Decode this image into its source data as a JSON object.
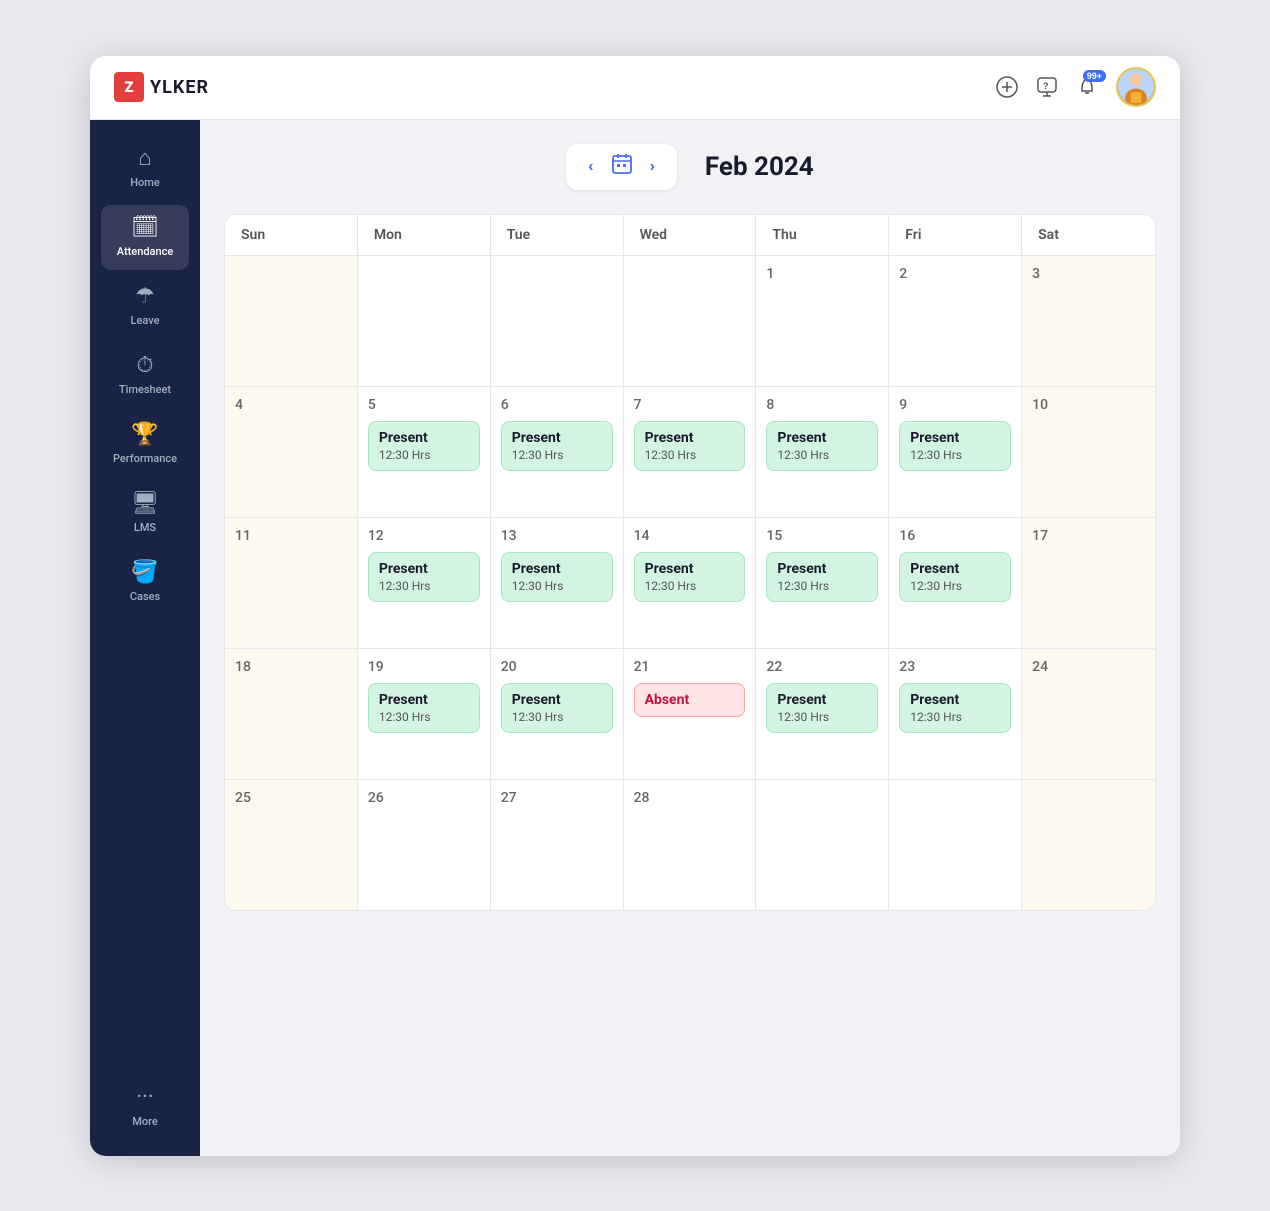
{
  "app": {
    "logo_letter": "Z",
    "logo_name": "YLKER"
  },
  "topbar": {
    "add_icon": "+",
    "help_icon": "?",
    "notif_badge": "99+",
    "notif_stars": "✦"
  },
  "sidebar": {
    "items": [
      {
        "id": "home",
        "label": "Home",
        "icon": "⌂",
        "active": false
      },
      {
        "id": "attendance",
        "label": "Attendance",
        "icon": "🗓",
        "active": true
      },
      {
        "id": "leave",
        "label": "Leave",
        "icon": "☂",
        "active": false
      },
      {
        "id": "timesheet",
        "label": "Timesheet",
        "icon": "⏱",
        "active": false
      },
      {
        "id": "performance",
        "label": "Performance",
        "icon": "🏆",
        "active": false
      },
      {
        "id": "lms",
        "label": "LMS",
        "icon": "🖥",
        "active": false
      },
      {
        "id": "cases",
        "label": "Cases",
        "icon": "🪣",
        "active": false
      },
      {
        "id": "more",
        "label": "More",
        "icon": "···",
        "active": false
      }
    ]
  },
  "calendar": {
    "prev_label": "‹",
    "next_label": "›",
    "month_year": "Feb 2024",
    "days": [
      "Sun",
      "Mon",
      "Tue",
      "Wed",
      "Thu",
      "Fri",
      "Sat"
    ],
    "rows": [
      [
        {
          "date": "",
          "events": [],
          "weekend": true
        },
        {
          "date": "",
          "events": []
        },
        {
          "date": "",
          "events": []
        },
        {
          "date": "",
          "events": []
        },
        {
          "date": "1",
          "events": []
        },
        {
          "date": "2",
          "events": []
        },
        {
          "date": "3",
          "events": [],
          "weekend": true
        }
      ],
      [
        {
          "date": "4",
          "events": [],
          "weekend": true
        },
        {
          "date": "5",
          "events": [
            {
              "type": "present",
              "title": "Present",
              "time": "12:30 Hrs"
            }
          ]
        },
        {
          "date": "6",
          "events": [
            {
              "type": "present",
              "title": "Present",
              "time": "12:30 Hrs"
            }
          ]
        },
        {
          "date": "7",
          "events": [
            {
              "type": "present",
              "title": "Present",
              "time": "12:30 Hrs"
            }
          ]
        },
        {
          "date": "8",
          "events": [
            {
              "type": "present",
              "title": "Present",
              "time": "12:30 Hrs"
            }
          ]
        },
        {
          "date": "9",
          "events": [
            {
              "type": "present",
              "title": "Present",
              "time": "12:30 Hrs"
            }
          ]
        },
        {
          "date": "10",
          "events": [],
          "weekend": true
        }
      ],
      [
        {
          "date": "11",
          "events": [],
          "weekend": true
        },
        {
          "date": "12",
          "events": [
            {
              "type": "present",
              "title": "Present",
              "time": "12:30 Hrs"
            }
          ]
        },
        {
          "date": "13",
          "events": [
            {
              "type": "present",
              "title": "Present",
              "time": "12:30 Hrs"
            }
          ]
        },
        {
          "date": "14",
          "events": [
            {
              "type": "present",
              "title": "Present",
              "time": "12:30 Hrs"
            }
          ]
        },
        {
          "date": "15",
          "events": [
            {
              "type": "present",
              "title": "Present",
              "time": "12:30 Hrs"
            }
          ]
        },
        {
          "date": "16",
          "events": [
            {
              "type": "present",
              "title": "Present",
              "time": "12:30 Hrs"
            }
          ]
        },
        {
          "date": "17",
          "events": [],
          "weekend": true
        }
      ],
      [
        {
          "date": "18",
          "events": [],
          "weekend": true
        },
        {
          "date": "19",
          "events": [
            {
              "type": "present",
              "title": "Present",
              "time": "12:30 Hrs"
            }
          ]
        },
        {
          "date": "20",
          "events": [
            {
              "type": "present",
              "title": "Present",
              "time": "12:30 Hrs"
            }
          ]
        },
        {
          "date": "21",
          "events": [
            {
              "type": "absent",
              "title": "Absent",
              "time": ""
            }
          ]
        },
        {
          "date": "22",
          "events": [
            {
              "type": "present",
              "title": "Present",
              "time": "12:30 Hrs"
            }
          ]
        },
        {
          "date": "23",
          "events": [
            {
              "type": "present",
              "title": "Present",
              "time": "12:30 Hrs"
            }
          ]
        },
        {
          "date": "24",
          "events": [],
          "weekend": true
        }
      ],
      [
        {
          "date": "25",
          "events": [],
          "weekend": true
        },
        {
          "date": "26",
          "events": []
        },
        {
          "date": "27",
          "events": []
        },
        {
          "date": "28",
          "events": []
        },
        {
          "date": "",
          "events": []
        },
        {
          "date": "",
          "events": []
        },
        {
          "date": "",
          "events": [],
          "weekend": true
        }
      ]
    ]
  }
}
